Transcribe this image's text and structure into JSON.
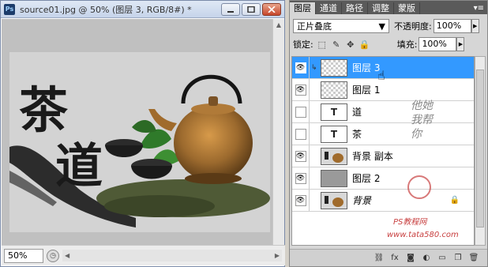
{
  "document": {
    "title": "source01.jpg @ 50% (图层 3, RGB/8#) *",
    "app_badge": "Ps",
    "zoom": "50%",
    "artwork_text": {
      "char1": "茶",
      "char2": "道"
    }
  },
  "panel": {
    "tabs": [
      "图层",
      "通道",
      "路径",
      "调整",
      "蒙版"
    ],
    "active_tab": 0,
    "blend_mode": "正片叠底",
    "opacity_label": "不透明度:",
    "opacity_value": "100%",
    "lock_label": "锁定:",
    "fill_label": "填充:",
    "fill_value": "100%",
    "layers": [
      {
        "name": "图层 3",
        "thumb": "checker",
        "visible": true,
        "selected": true,
        "clipped": true
      },
      {
        "name": "图层 1",
        "thumb": "checker",
        "visible": true,
        "selected": false,
        "clipped": false
      },
      {
        "name": "道",
        "thumb": "T",
        "visible": false,
        "selected": false,
        "clipped": false
      },
      {
        "name": "茶",
        "thumb": "T",
        "visible": false,
        "selected": false,
        "clipped": false
      },
      {
        "name": "背景 副本",
        "thumb": "img",
        "visible": true,
        "selected": false,
        "clipped": false
      },
      {
        "name": "图层 2",
        "thumb": "gray",
        "visible": true,
        "selected": false,
        "clipped": false
      },
      {
        "name": "背景",
        "thumb": "img",
        "visible": true,
        "selected": false,
        "clipped": false,
        "locked": true
      }
    ]
  },
  "watermark": {
    "signature": "他她我帮你",
    "line1": "PS教程网",
    "line2": "www.tata580.com"
  },
  "colors": {
    "selection": "#3399ff",
    "canvas_bg": "#c0c0c0",
    "panel_tabbar": "#5a5a5a"
  }
}
